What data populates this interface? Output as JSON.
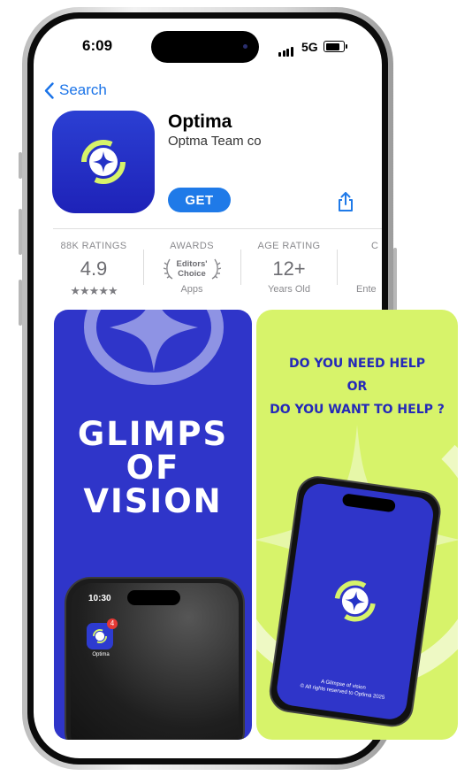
{
  "status_bar": {
    "time": "6:09",
    "network": "5G"
  },
  "nav": {
    "back_label": "Search"
  },
  "app": {
    "name": "Optima",
    "developer": "Optma Team co",
    "get_label": "GET"
  },
  "stats": [
    {
      "header": "88K RATINGS",
      "value": "4.9",
      "sub": "★★★★★"
    },
    {
      "header": "AWARDS",
      "value_line1": "Editors'",
      "value_line2": "Choice",
      "sub": "Apps"
    },
    {
      "header": "AGE RATING",
      "value": "12+",
      "sub": "Years Old"
    },
    {
      "header": "C",
      "sub": "Ente"
    }
  ],
  "screenshots": {
    "shot1": {
      "title_l1": "GLIMPS",
      "title_l2": "OF",
      "title_l3": "VISION",
      "phone_time": "10:30",
      "badge": "4",
      "app_label": "Optima"
    },
    "shot2": {
      "line1": "DO YOU NEED HELP",
      "line2": "OR",
      "line3": "DO YOU WANT TO HELP ?",
      "caption_l1": "A Glimpse of vision",
      "caption_l2": "© All rights reserved to Optima 2025"
    }
  },
  "colors": {
    "accent": "#1f7ae8",
    "brand_blue": "#2f35c9",
    "brand_lime": "#d7f36a"
  },
  "icons": [
    "chevron-left-icon",
    "share-icon",
    "laurel-icon",
    "optima-logo-icon",
    "signal-icon",
    "battery-icon"
  ]
}
